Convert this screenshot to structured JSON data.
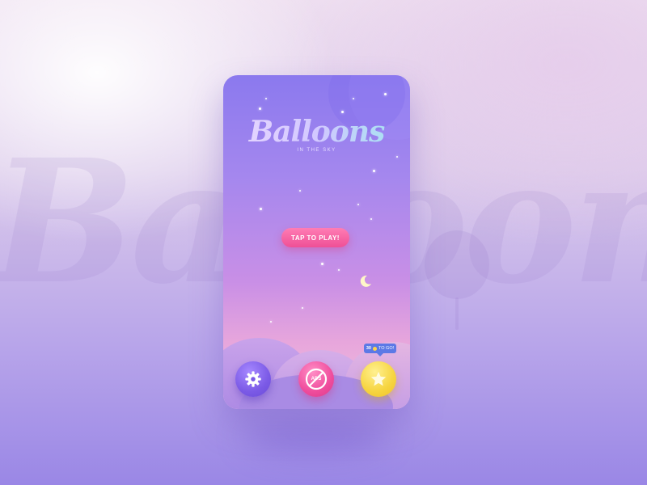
{
  "background": {
    "wordmark": "Balloons"
  },
  "game": {
    "title": "Balloons",
    "subtitle": "IN THE SKY",
    "play_label": "TAP TO PLAY!",
    "controls": {
      "settings_icon": "gear-icon",
      "ads_label": "ADS",
      "rate_icon": "star-icon"
    },
    "tooltip": {
      "count": "30",
      "label": "TO GO!",
      "icon": "coin-icon"
    }
  },
  "colors": {
    "accent_pink": "#ef4f96",
    "accent_purple": "#7b5ae6",
    "accent_yellow": "#f6d43e",
    "tooltip_blue": "#5c79e6"
  }
}
